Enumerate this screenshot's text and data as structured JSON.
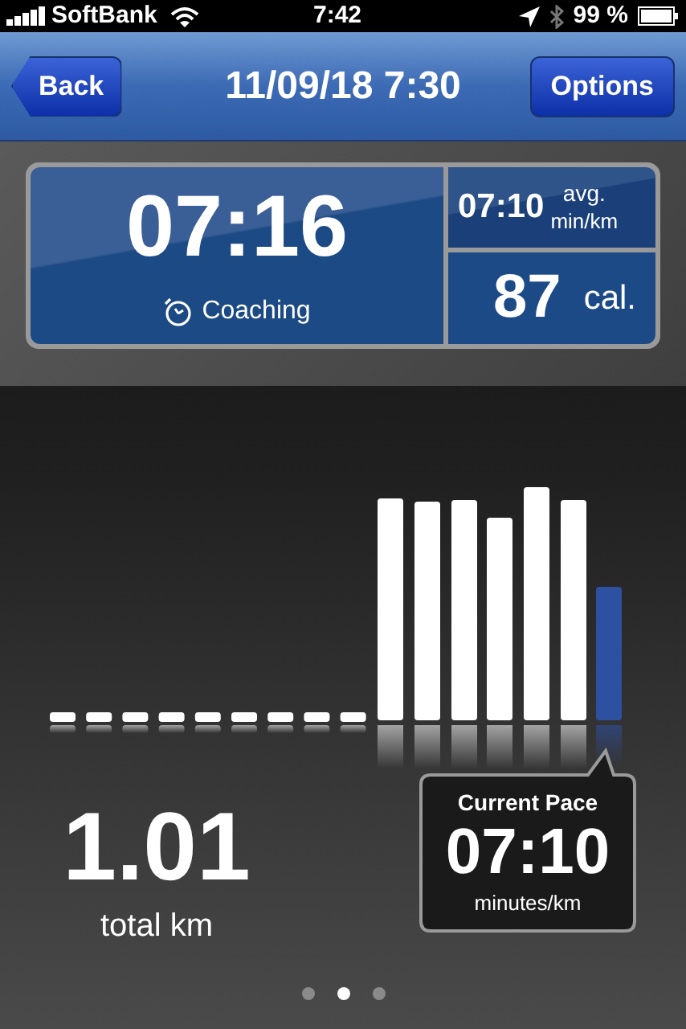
{
  "status_bar": {
    "carrier": "SoftBank",
    "time": "7:42",
    "battery": "99 %"
  },
  "nav": {
    "back": "Back",
    "title": "11/09/18 7:30",
    "options": "Options"
  },
  "stats": {
    "time": "07:16",
    "coaching": "Coaching",
    "avg_pace": "07:10",
    "avg_label": "avg.",
    "avg_unit": "min/km",
    "calories": "87",
    "calories_unit": "cal."
  },
  "distance": {
    "value": "1.01",
    "label": "total km"
  },
  "current_pace": {
    "title": "Current Pace",
    "value": "07:10",
    "unit": "minutes/km"
  },
  "page_dots": [
    {
      "selected": false
    },
    {
      "selected": true
    },
    {
      "selected": false
    }
  ]
}
